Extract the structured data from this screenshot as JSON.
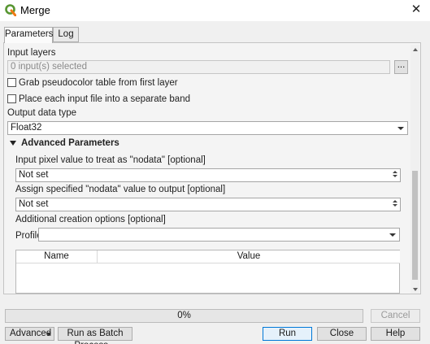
{
  "window": {
    "title": "Merge"
  },
  "tabs": [
    {
      "label": "Parameters"
    },
    {
      "label": "Log"
    }
  ],
  "params": {
    "input_layers_label": "Input layers",
    "input_layers_value": "0 input(s) selected",
    "browse_label": "...",
    "grab_pseudocolor_label": "Grab pseudocolor table from first layer",
    "separate_band_label": "Place each input file into a separate band",
    "output_data_type_label": "Output data type",
    "output_data_type_value": "Float32",
    "advanced_header": "Advanced Parameters",
    "nodata_input_label": "Input pixel value to treat as \"nodata\" [optional]",
    "nodata_input_value": "Not set",
    "nodata_output_label": "Assign specified \"nodata\" value to output [optional]",
    "nodata_output_value": "Not set",
    "creation_options_label": "Additional creation options [optional]",
    "profile_label": "Profile",
    "profile_value": ""
  },
  "table": {
    "headers": [
      "Name",
      "Value"
    ]
  },
  "progress": {
    "text": "0%",
    "value": 0
  },
  "buttons": {
    "cancel": "Cancel",
    "advanced": "Advanced",
    "batch": "Run as Batch Process...",
    "run": "Run",
    "close": "Close",
    "help": "Help"
  }
}
